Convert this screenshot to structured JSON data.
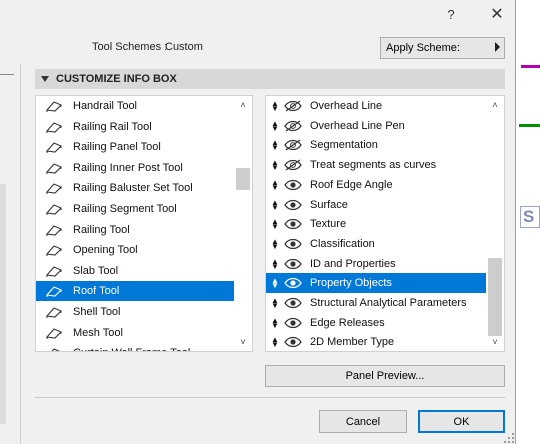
{
  "titlebar": {
    "help_glyph": "?",
    "close_glyph": "✕"
  },
  "scheme": {
    "label": "Tool Schemes :",
    "value": "Custom",
    "apply_label": "Apply Scheme:"
  },
  "section": {
    "title": "CUSTOMIZE INFO BOX"
  },
  "tools": [
    {
      "label": "Handrail Tool",
      "icon": "handrail-icon"
    },
    {
      "label": "Railing Rail Tool",
      "icon": "railing-rail-icon"
    },
    {
      "label": "Railing Panel Tool",
      "icon": "railing-panel-icon"
    },
    {
      "label": "Railing Inner Post Tool",
      "icon": "railing-inner-post-icon"
    },
    {
      "label": "Railing Baluster Set Tool",
      "icon": "railing-baluster-icon"
    },
    {
      "label": "Railing Segment Tool",
      "icon": "railing-segment-icon"
    },
    {
      "label": "Railing Tool",
      "icon": "railing-icon"
    },
    {
      "label": "Opening Tool",
      "icon": "opening-icon"
    },
    {
      "label": "Slab Tool",
      "icon": "slab-icon"
    },
    {
      "label": "Roof Tool",
      "icon": "roof-icon",
      "selected": true
    },
    {
      "label": "Shell Tool",
      "icon": "shell-icon"
    },
    {
      "label": "Mesh Tool",
      "icon": "mesh-icon"
    },
    {
      "label": "Curtain Wall Frame Tool",
      "icon": "curtain-wall-frame-icon"
    }
  ],
  "properties": [
    {
      "label": "Overhead Line",
      "visible": false
    },
    {
      "label": "Overhead Line Pen",
      "visible": false
    },
    {
      "label": "Segmentation",
      "visible": false
    },
    {
      "label": "Treat segments as curves",
      "visible": false
    },
    {
      "label": "Roof Edge Angle",
      "visible": true
    },
    {
      "label": "Surface",
      "visible": true
    },
    {
      "label": "Texture",
      "visible": true
    },
    {
      "label": "Classification",
      "visible": true
    },
    {
      "label": "ID and Properties",
      "visible": true
    },
    {
      "label": "Property Objects",
      "visible": true,
      "selected": true
    },
    {
      "label": "Structural Analytical Parameters",
      "visible": true
    },
    {
      "label": "Edge Releases",
      "visible": true
    },
    {
      "label": "2D Member Type",
      "visible": true
    }
  ],
  "buttons": {
    "panel_preview": "Panel Preview...",
    "cancel": "Cancel",
    "ok": "OK"
  },
  "colors": {
    "selection": "#0078d7",
    "magenta_line": "#b000b0",
    "green_line": "#009000"
  }
}
